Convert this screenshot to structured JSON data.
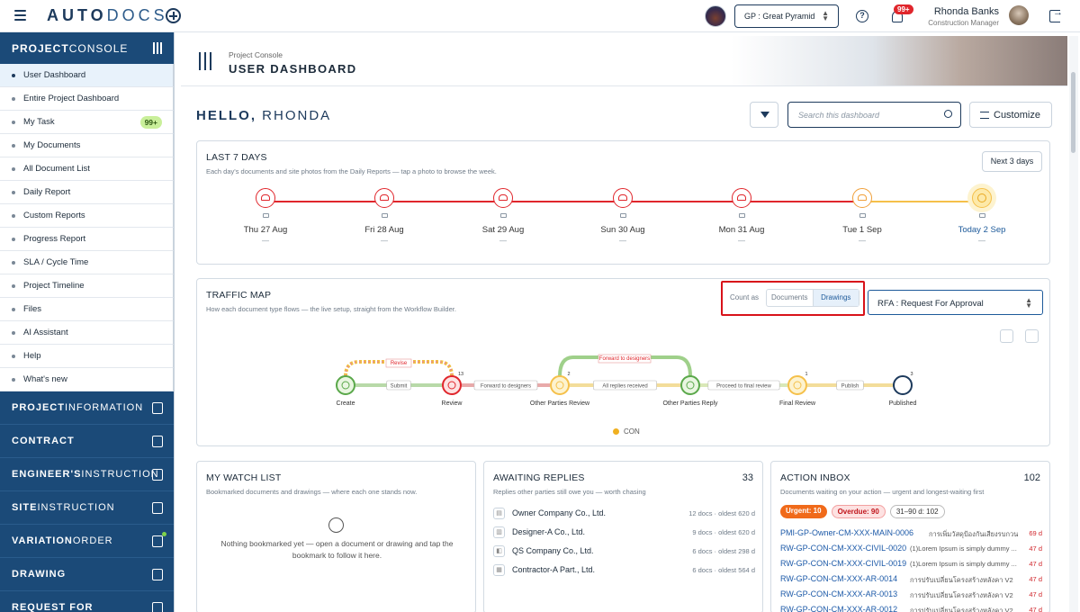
{
  "app": {
    "logo_bold": "AUTO",
    "logo_rest": "DOCS"
  },
  "topbar": {
    "project_select": "GP : Great Pyramid",
    "notif_count": "99+",
    "user_name": "Rhonda Banks",
    "user_role": "Construction Manager"
  },
  "sidebar": {
    "header_bold": "PROJECT",
    "header_rest": " CONSOLE",
    "items": [
      {
        "label": "User Dashboard"
      },
      {
        "label": "Entire Project Dashboard"
      },
      {
        "label": "My Task",
        "count": "99+"
      },
      {
        "label": "My Documents"
      },
      {
        "label": "All Document List"
      },
      {
        "label": "Daily Report"
      },
      {
        "label": "Custom Reports"
      },
      {
        "label": "Progress Report"
      },
      {
        "label": "SLA / Cycle Time"
      },
      {
        "label": "Project Timeline"
      },
      {
        "label": "Files"
      },
      {
        "label": "AI Assistant"
      },
      {
        "label": "Help"
      },
      {
        "label": "What's new"
      }
    ],
    "sections": [
      {
        "bold": "PROJECT",
        "rest": " INFORMATION"
      },
      {
        "bold": "CONTRACT",
        "rest": ""
      },
      {
        "bold": "ENGINEER'S",
        "rest": " INSTRUCTION"
      },
      {
        "bold": "SITE",
        "rest": " INSTRUCTION"
      },
      {
        "bold": "VARIATION",
        "rest": " ORDER"
      },
      {
        "bold": "DRAWING",
        "rest": ""
      },
      {
        "bold": "REQUEST FOR",
        "rest": ""
      }
    ]
  },
  "page": {
    "breadcrumb": "Project Console",
    "title": "USER DASHBOARD",
    "hello_pre": "HELLO,",
    "hello_name": " RHONDA",
    "search_placeholder": "Search this dashboard",
    "customize": "Customize"
  },
  "last7": {
    "title": "LAST 7 DAYS",
    "subtitle": "Each day's documents and site photos from the Daily Reports — tap a photo to browse the week.",
    "next_btn": "Next 3 days",
    "days": [
      {
        "label": "Thu 27 Aug",
        "value": "—"
      },
      {
        "label": "Fri 28 Aug",
        "value": "—"
      },
      {
        "label": "Sat 29 Aug",
        "value": "—"
      },
      {
        "label": "Sun 30 Aug",
        "value": "—"
      },
      {
        "label": "Mon 31 Aug",
        "value": "—"
      },
      {
        "label": "Tue 1 Sep",
        "value": "—"
      },
      {
        "label": "Today 2 Sep",
        "value": "—"
      }
    ]
  },
  "traffic": {
    "title": "TRAFFIC MAP",
    "subtitle": "How each document type flows — the live setup, straight from the Workflow Builder.",
    "count_as": "Count as",
    "seg_documents": "Documents",
    "seg_drawings": "Drawings",
    "workflow": "RFA : Request For Approval",
    "nodes": [
      "Create",
      "Review",
      "Other Parties Review",
      "Other Parties Reply",
      "Final Review",
      "Published"
    ],
    "node_counts": [
      "",
      "13",
      "2",
      "",
      "1",
      "3"
    ],
    "edges": [
      "Submit",
      "Forward to designers",
      "All replies received",
      "Proceed to final review",
      "Publish"
    ],
    "loop_revise": "Revise",
    "loop_forward": "Forward to designers",
    "legend": "CON"
  },
  "watch": {
    "title": "MY WATCH LIST",
    "subtitle": "Bookmarked documents and drawings — where each one stands now.",
    "empty": "Nothing bookmarked yet — open a document or drawing and tap the bookmark to follow it here."
  },
  "await": {
    "title": "AWAITING REPLIES",
    "count": "33",
    "subtitle": "Replies other parties still owe you — worth chasing",
    "rows": [
      {
        "name": "Owner Company Co., Ltd.",
        "meta": "12 docs · oldest 620 d"
      },
      {
        "name": "Designer-A Co., Ltd.",
        "meta": "9 docs · oldest 620 d"
      },
      {
        "name": "QS Company Co., Ltd.",
        "meta": "6 docs · oldest 298 d"
      },
      {
        "name": "Contractor-A Part., Ltd.",
        "meta": "6 docs · oldest 564 d"
      }
    ]
  },
  "inbox": {
    "title": "ACTION INBOX",
    "count": "102",
    "subtitle": "Documents waiting on your action — urgent and longest-waiting first",
    "chip_urgent": "Urgent: 10",
    "chip_overdue": "Overdue: 90",
    "chip_range": "31–90 d: 102",
    "rows": [
      {
        "code": "PMI-GP-Owner-CM-XXX-MAIN-0006",
        "desc": "การเพิ่มวัสดุป้องกันเสียงรบกวน",
        "days": "69 d"
      },
      {
        "code": "RW-GP-CON-CM-XXX-CIVIL-0020",
        "desc": "(1)Lorem Ipsum is simply dummy ...",
        "days": "47 d"
      },
      {
        "code": "RW-GP-CON-CM-XXX-CIVIL-0019",
        "desc": "(1)Lorem Ipsum is simply dummy ...",
        "days": "47 d"
      },
      {
        "code": "RW-GP-CON-CM-XXX-AR-0014",
        "desc": "การปรับเปลี่ยนโครงสร้างหลังคา V2",
        "days": "47 d"
      },
      {
        "code": "RW-GP-CON-CM-XXX-AR-0013",
        "desc": "การปรับเปลี่ยนโครงสร้างหลังคา V2",
        "days": "47 d"
      },
      {
        "code": "RW-GP-CON-CM-XXX-AR-0012",
        "desc": "การปรับเปลี่ยนโครงสร้างหลังคา V2",
        "days": "47 d"
      }
    ]
  },
  "colors": {
    "brand": "#1b4a78",
    "red": "#e0262c",
    "yellow": "#f5c04a",
    "green": "#5aa84a"
  }
}
